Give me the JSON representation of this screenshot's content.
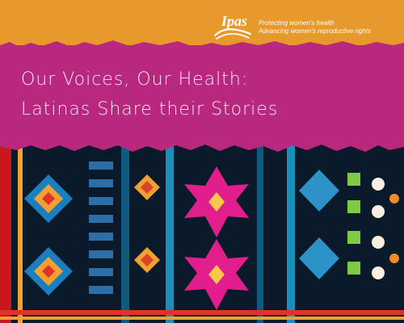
{
  "brand": {
    "logo_text": "Ipas",
    "tagline_line1": "Protecting women's health",
    "tagline_line2": "Advancing women's reproductive rights"
  },
  "headline": {
    "line1": "Our Voices, Our Health:",
    "line2": "Latinas Share their Stories"
  },
  "colors": {
    "orange": "#e79a2b",
    "magenta": "#b8287e",
    "textile_bg": "#0b1a2b"
  },
  "icons": {
    "logo": "ipas-logo-icon",
    "textile": "woven-textile-pattern-icon"
  }
}
